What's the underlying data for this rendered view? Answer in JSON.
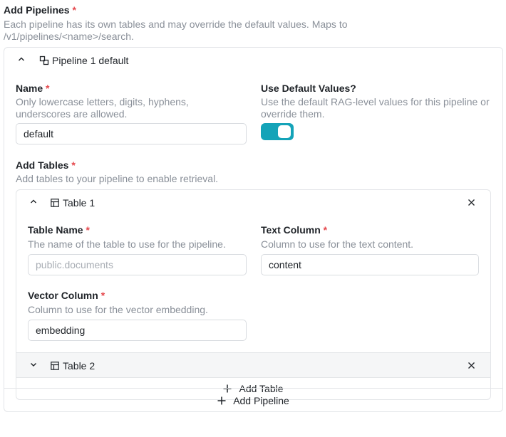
{
  "section": {
    "title": "Add Pipelines",
    "required": "*",
    "help": "Each pipeline has its own tables and may override the default values. Maps to /v1/pipelines/<name>/search."
  },
  "pipeline": {
    "title": "Pipeline 1",
    "subtitle": "default",
    "name_label": "Name",
    "name_help": "Only lowercase letters, digits, hyphens, underscores are allowed.",
    "name_value": "default",
    "defaults_label": "Use Default Values?",
    "defaults_help": "Use the default RAG-level values for this pipeline or override them.",
    "defaults_on": true,
    "tables_label": "Add Tables",
    "tables_help": "Add tables to your pipeline to enable retrieval.",
    "add_pipeline_label": "Add Pipeline"
  },
  "tables": [
    {
      "title": "Table 1",
      "table_name_label": "Table Name",
      "table_name_help": "The name of the table to use for the pipeline.",
      "table_name_placeholder": "public.documents",
      "text_column_label": "Text Column",
      "text_column_help": "Column to use for the text content.",
      "text_column_value": "content",
      "vector_column_label": "Vector Column",
      "vector_column_help": "Column to use for the vector embedding.",
      "vector_column_value": "embedding"
    },
    {
      "title": "Table 2"
    }
  ],
  "add_table_label": "Add Table",
  "colors": {
    "accent": "#14a3b8",
    "required": "#e5484d",
    "help_text": "#8a9099",
    "border": "#e3e5e8"
  },
  "icons": {
    "collapse": "chevron-up-icon",
    "expand": "chevron-down-icon",
    "pipeline": "pipeline-icon",
    "table": "table-icon",
    "remove": "close-icon",
    "add": "plus-icon"
  }
}
